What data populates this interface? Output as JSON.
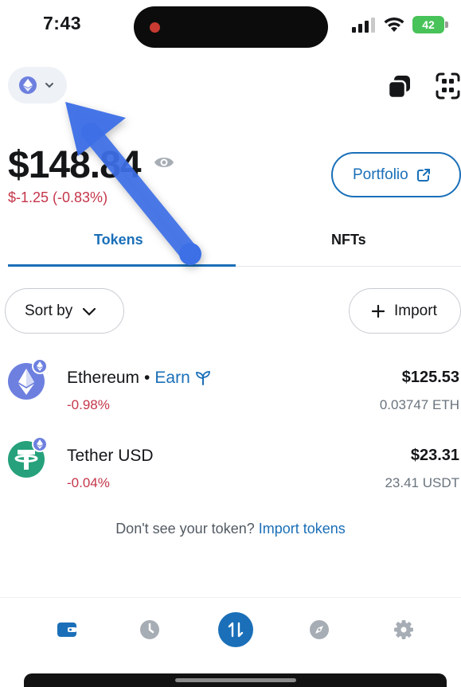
{
  "status_bar": {
    "time": "7:43",
    "battery": "42"
  },
  "header": {
    "network_icon": "ethereum-icon",
    "copy_icon": "copy-icon",
    "scan_icon": "qr-scan-icon"
  },
  "balance": {
    "amount": "$148.84",
    "change": "$-1.25 (-0.83%)",
    "visibility_icon": "eye-icon"
  },
  "portfolio_button": {
    "label": "Portfolio",
    "icon": "external-link-icon"
  },
  "tabs": [
    {
      "label": "Tokens",
      "active": true
    },
    {
      "label": "NFTs",
      "active": false
    }
  ],
  "controls": {
    "sort_label": "Sort by",
    "import_label": "Import"
  },
  "tokens": [
    {
      "name": "Ethereum",
      "separator": "•",
      "earn": "Earn",
      "change": "-0.98%",
      "fiat": "$125.53",
      "amount": "0.03747 ETH",
      "icon": "ethereum-icon"
    },
    {
      "name": "Tether USD",
      "change": "-0.04%",
      "fiat": "$23.31",
      "amount": "23.41 USDT",
      "icon": "tether-icon"
    }
  ],
  "import_hint": {
    "text": "Don't see your token?",
    "link": "Import tokens"
  },
  "bottom_nav": [
    {
      "name": "wallet-icon",
      "active": true
    },
    {
      "name": "activity-clock-icon",
      "active": false
    },
    {
      "name": "swap-bridge-icon",
      "active": false
    },
    {
      "name": "explore-compass-icon",
      "active": false
    },
    {
      "name": "settings-gear-icon",
      "active": false
    }
  ],
  "colors": {
    "accent": "#1a6fb8",
    "negative": "#c4364a",
    "tutorial_arrow": "#3d6fe6",
    "eth": "#6d80df",
    "tether": "#26a17b"
  }
}
